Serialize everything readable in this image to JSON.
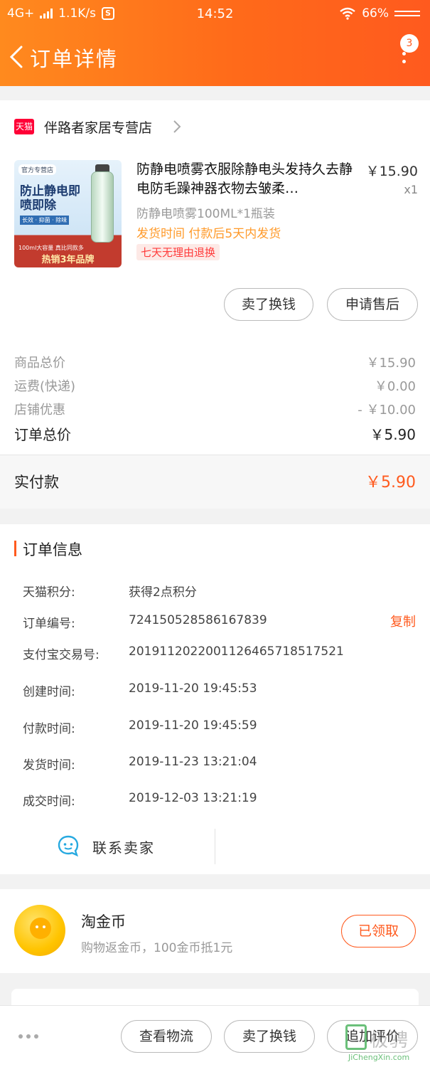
{
  "status_bar": {
    "network": "4G+",
    "speed": "1.1K/s",
    "app_icon_letter": "S",
    "time": "14:52",
    "battery": "66%"
  },
  "header": {
    "title": "订单详情",
    "badge_count": "3"
  },
  "shop": {
    "logo_text": "天猫",
    "name": "伴路者家居专营店"
  },
  "product": {
    "image": {
      "tag": "官方专营店",
      "headline": "防止静电即喷即除",
      "subline": "长效 · 抑菌 · 除味",
      "strip": "100ml大容量 真比同款多",
      "bottom": "热销3年品牌"
    },
    "title": "防静电喷雾衣服除静电头发持久去静电防毛躁神器衣物去皱柔…",
    "price": "￥15.90",
    "quantity": "x1",
    "spec": "防静电喷雾100ML*1瓶装",
    "shipping": "发货时间  付款后5天内发货",
    "tag": "七天无理由退换"
  },
  "actions": {
    "sell_label": "卖了换钱",
    "after_sale_label": "申请售后"
  },
  "summary": {
    "rows": [
      {
        "label": "商品总价",
        "value": "￥15.90"
      },
      {
        "label": "运费(快递)",
        "value": "￥0.00"
      },
      {
        "label": "店铺优惠",
        "value": "- ￥10.00"
      }
    ],
    "total_label": "订单总价",
    "total_value": "￥5.90",
    "paid_label": "实付款",
    "paid_value": "￥5.90"
  },
  "order_info": {
    "title": "订单信息",
    "rows": [
      {
        "label": "天猫积分:",
        "value": "获得2点积分"
      },
      {
        "label": "订单编号:",
        "value": "724150528586167839"
      },
      {
        "label": "支付宝交易号:",
        "value": "2019112022001126465718517521"
      },
      {
        "label": "创建时间:",
        "value": "2019-11-20 19:45:53"
      },
      {
        "label": "付款时间:",
        "value": "2019-11-20 19:45:59"
      },
      {
        "label": "发货时间:",
        "value": "2019-11-23 13:21:04"
      },
      {
        "label": "成交时间:",
        "value": "2019-12-03 13:21:19"
      }
    ],
    "copy_label": "复制",
    "contact_label": "联系卖家"
  },
  "coin": {
    "title": "淘金币",
    "subtitle": "购物返金币，100金币抵1元",
    "button": "已领取"
  },
  "bottom_bar": {
    "logistics": "查看物流",
    "sell": "卖了换钱",
    "review": "追加评价"
  },
  "watermark": {
    "text": "极骋",
    "url": "JiChengXin.com"
  },
  "colors": {
    "accent": "#ff5a1e",
    "header_start": "#ff8a1e",
    "tmall_red": "#ff0036",
    "ship_orange": "#ff9a2a"
  }
}
